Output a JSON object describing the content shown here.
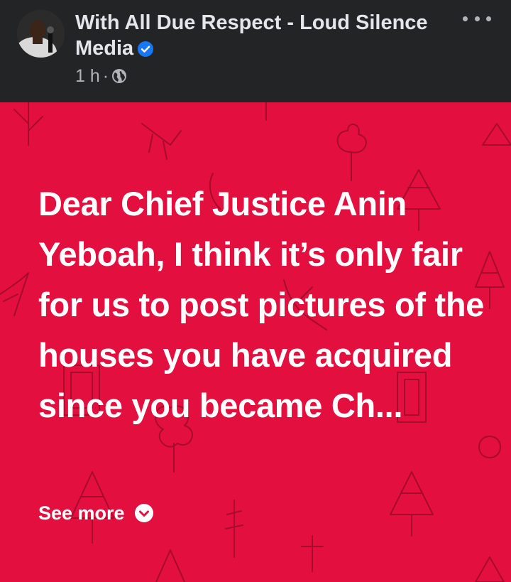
{
  "header": {
    "page_name": "With All Due Respect - Loud Silence Media",
    "verified_icon": "verified-badge-icon",
    "time": "1 h",
    "separator": "·",
    "audience_icon": "globe-icon",
    "more_icon": "more-options-icon"
  },
  "post": {
    "background_color": "#e3103f",
    "text": "Dear Chief Justice Anin Yeboah, I think it’s only fair for us to post pictures of the houses you have acquired since you became Ch...",
    "see_more_label": "See more",
    "see_more_icon": "chevron-down-circle-icon"
  },
  "colors": {
    "header_bg": "#232426",
    "verified": "#1877f2",
    "text_primary": "#e4e6eb",
    "text_secondary": "#b0b3b8"
  }
}
